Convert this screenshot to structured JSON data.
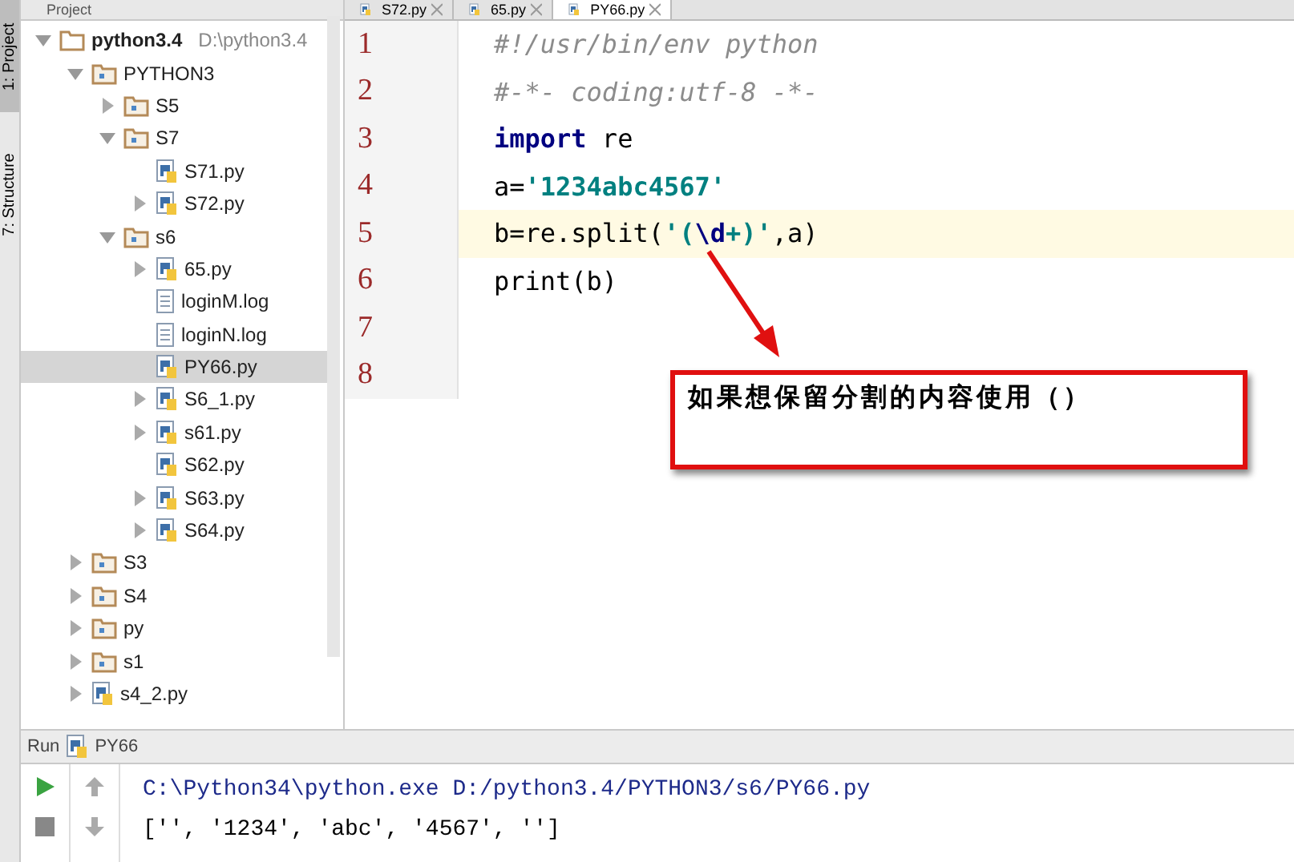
{
  "side_strip": {
    "tabs": [
      {
        "label": "1: Project",
        "selected": true
      },
      {
        "label": "7: Structure",
        "selected": false
      }
    ]
  },
  "project_panel": {
    "title": "Project",
    "tree": [
      {
        "label": "python3.4",
        "path": "D:\\python3.4",
        "kind": "root",
        "expanded": true,
        "selected": false,
        "children": [
          {
            "label": "PYTHON3",
            "kind": "folder",
            "expanded": true,
            "selected": false,
            "children": [
              {
                "label": "S5",
                "kind": "folder",
                "expanded": false,
                "selected": false
              },
              {
                "label": "S7",
                "kind": "folder",
                "expanded": true,
                "selected": false,
                "children": [
                  {
                    "label": "S71.py",
                    "kind": "python",
                    "selected": false
                  },
                  {
                    "label": "S72.py",
                    "kind": "python",
                    "expanded": false,
                    "selected": false
                  }
                ]
              },
              {
                "label": "s6",
                "kind": "folder",
                "expanded": true,
                "selected": false,
                "children": [
                  {
                    "label": "65.py",
                    "kind": "python",
                    "expanded": false,
                    "selected": false
                  },
                  {
                    "label": "loginM.log",
                    "kind": "log",
                    "selected": false
                  },
                  {
                    "label": "loginN.log",
                    "kind": "log",
                    "selected": false
                  },
                  {
                    "label": "PY66.py",
                    "kind": "python",
                    "selected": true
                  },
                  {
                    "label": "S6_1.py",
                    "kind": "python",
                    "expanded": false,
                    "selected": false
                  },
                  {
                    "label": "s61.py",
                    "kind": "python",
                    "expanded": false,
                    "selected": false
                  },
                  {
                    "label": "S62.py",
                    "kind": "python",
                    "selected": false
                  },
                  {
                    "label": "S63.py",
                    "kind": "python",
                    "expanded": false,
                    "selected": false
                  },
                  {
                    "label": "S64.py",
                    "kind": "python",
                    "expanded": false,
                    "selected": false
                  }
                ]
              }
            ]
          },
          {
            "label": "S3",
            "kind": "folder",
            "expanded": false,
            "selected": false
          },
          {
            "label": "S4",
            "kind": "folder",
            "expanded": false,
            "selected": false
          },
          {
            "label": "py",
            "kind": "folder",
            "expanded": false,
            "selected": false
          },
          {
            "label": "s1",
            "kind": "folder",
            "expanded": false,
            "selected": false
          },
          {
            "label": "s4_2.py",
            "kind": "python",
            "expanded": false,
            "selected": false
          }
        ]
      }
    ]
  },
  "editor": {
    "tabs": [
      {
        "label": "S72.py",
        "selected": false
      },
      {
        "label": "65.py",
        "selected": false
      },
      {
        "label": "PY66.py",
        "selected": true
      }
    ],
    "lines": [
      {
        "number": "1",
        "current": false,
        "tokens": [
          {
            "kind": "comment",
            "text": "#!/usr/bin/env python"
          }
        ]
      },
      {
        "number": "2",
        "current": false,
        "tokens": [
          {
            "kind": "comment",
            "text": "#-*- coding:utf-8 -*-"
          }
        ]
      },
      {
        "number": "3",
        "current": false,
        "tokens": [
          {
            "kind": "keyword",
            "text": "import"
          },
          {
            "kind": "plain",
            "text": " re"
          }
        ]
      },
      {
        "number": "4",
        "current": false,
        "tokens": [
          {
            "kind": "plain",
            "text": "a="
          },
          {
            "kind": "string",
            "text": "'1234abc4567'"
          }
        ]
      },
      {
        "number": "5",
        "current": true,
        "tokens": [
          {
            "kind": "plain",
            "text": "b=re.split("
          },
          {
            "kind": "string",
            "text": "'("
          },
          {
            "kind": "escape",
            "text": "\\d"
          },
          {
            "kind": "string",
            "text": "+)'"
          },
          {
            "kind": "plain",
            "text": ",a)"
          }
        ]
      },
      {
        "number": "6",
        "current": false,
        "tokens": [
          {
            "kind": "plain",
            "text": "print(b)"
          }
        ]
      },
      {
        "number": "7",
        "current": false
      },
      {
        "number": "8",
        "current": false
      }
    ],
    "callout": {
      "text": "如果想保留分割的内容使用（）"
    }
  },
  "run_panel": {
    "label": "Run",
    "config": "PY66",
    "output": [
      "C:\\Python34\\python.exe D:/python3.4/PYTHON3/s6/PY66.py",
      "['', '1234', 'abc', '4567', '']"
    ]
  }
}
